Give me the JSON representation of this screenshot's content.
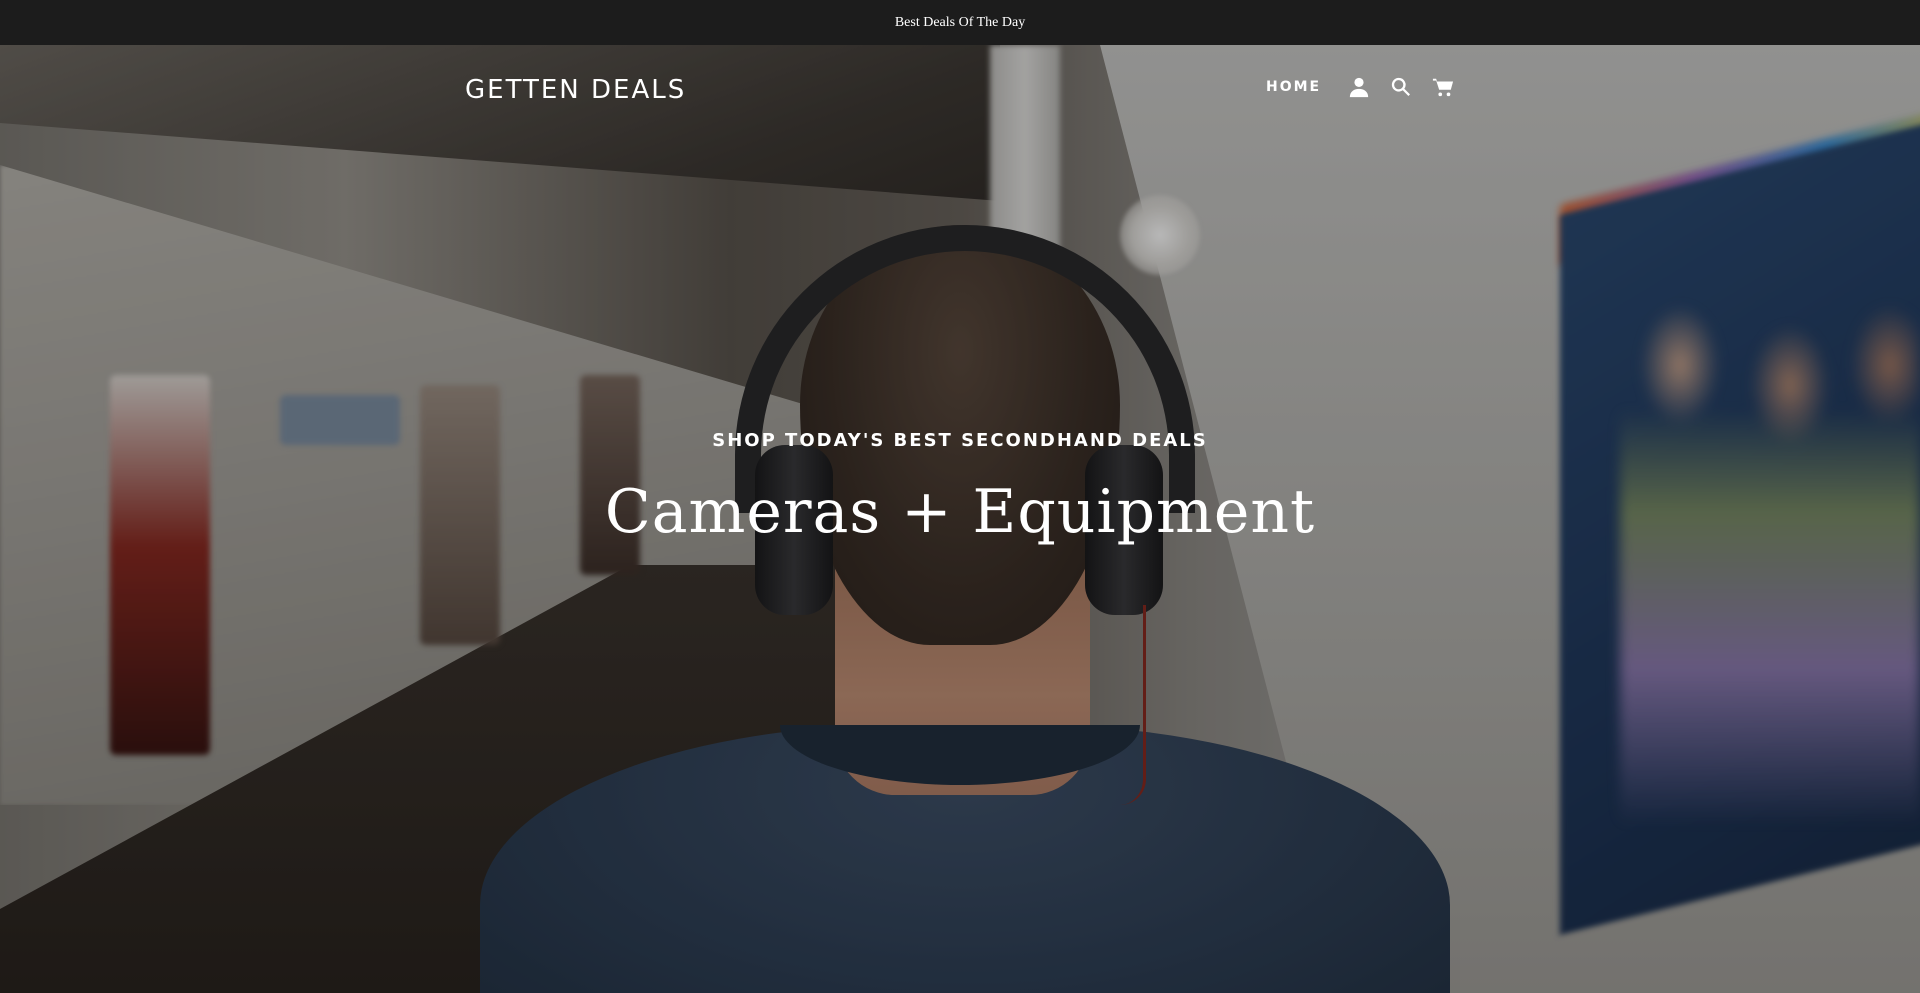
{
  "announcement": {
    "text": "Best Deals Of The Day"
  },
  "header": {
    "logo": "GETTEN DEALS",
    "nav": {
      "home_label": "HOME",
      "account_icon": "account-icon",
      "search_icon": "search-icon",
      "cart_icon": "cart-icon"
    }
  },
  "hero": {
    "subtitle": "SHOP TODAY'S BEST SECONDHAND DEALS",
    "title": "Cameras + Equipment",
    "background_image": "man-with-headphones-in-subway"
  },
  "colors": {
    "announcement_bg": "#1c1c1c",
    "text": "#ffffff"
  }
}
